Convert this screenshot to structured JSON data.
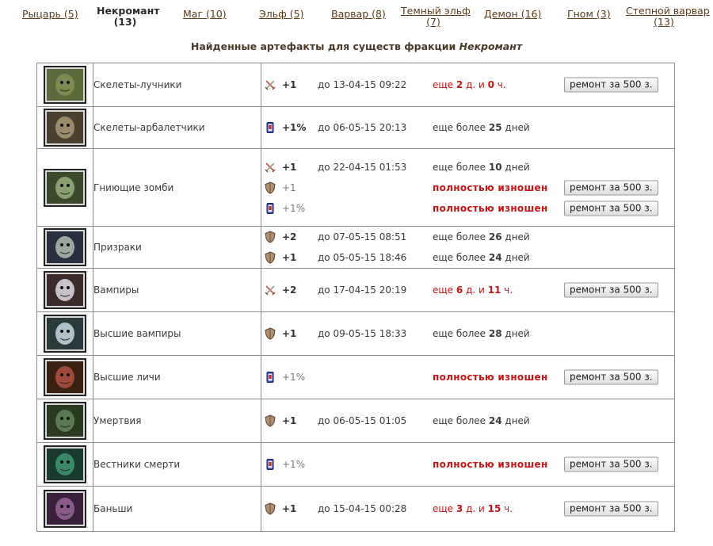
{
  "tabs": [
    {
      "label": "Рыцарь",
      "count": "(5)"
    },
    {
      "label": "Некромант",
      "count": "(13)"
    },
    {
      "label": "Маг",
      "count": "(10)"
    },
    {
      "label": "Эльф",
      "count": "(5)"
    },
    {
      "label": "Варвар",
      "count": "(8)"
    },
    {
      "label": "Темный эльф",
      "count": "(7)"
    },
    {
      "label": "Демон",
      "count": "(16)"
    },
    {
      "label": "Гном",
      "count": "(3)"
    },
    {
      "label": "Степной варвар",
      "count": "(13)"
    }
  ],
  "heading": {
    "prefix": "Найденные артефакты для существ фракции ",
    "faction": "Некромант"
  },
  "repair_label": "ремонт за 500 з.",
  "creatures": [
    {
      "name": "Скелеты-лучники",
      "artifacts": [
        {
          "icon": "swords-icon",
          "bonus": "+1",
          "date": "до 13-04-15 09:22",
          "status": {
            "pre": "еще ",
            "n1": "2",
            "mid": " д. и ",
            "n2": "0",
            "post": " ч."
          }
        }
      ]
    },
    {
      "name": "Скелеты-арбалетчики",
      "artifacts": [
        {
          "icon": "scroll-icon",
          "bonus": "+1%",
          "date": "до 06-05-15 20:13",
          "status": {
            "pre": "еще более ",
            "n1": "25",
            "post": " дней"
          }
        }
      ]
    },
    {
      "name": "Гниющие зомби",
      "artifacts": [
        {
          "icon": "swords-icon",
          "bonus": "+1",
          "date": "до 22-04-15 01:53",
          "status": {
            "pre": "еще более ",
            "n1": "10",
            "post": " дней"
          }
        },
        {
          "icon": "shield-icon",
          "bonus": "+1",
          "status": {
            "worn": "полностью изношен"
          }
        },
        {
          "icon": "scroll-icon",
          "bonus": "+1%",
          "status": {
            "worn": "полностью изношен"
          }
        }
      ]
    },
    {
      "name": "Призраки",
      "artifacts": [
        {
          "icon": "shield-icon",
          "bonus": "+2",
          "date": "до 07-05-15 08:51",
          "status": {
            "pre": "еще более ",
            "n1": "26",
            "post": " дней"
          }
        },
        {
          "icon": "shield-icon",
          "bonus": "+1",
          "date": "до 05-05-15 18:46",
          "status": {
            "pre": "еще более ",
            "n1": "24",
            "post": " дней"
          }
        }
      ]
    },
    {
      "name": "Вампиры",
      "artifacts": [
        {
          "icon": "swords-icon",
          "bonus": "+2",
          "date": "до 17-04-15 20:19",
          "status": {
            "pre": "еще ",
            "n1": "6",
            "mid": " д. и ",
            "n2": "11",
            "post": " ч."
          }
        }
      ]
    },
    {
      "name": "Высшие вампиры",
      "artifacts": [
        {
          "icon": "shield-icon",
          "bonus": "+1",
          "date": "до 09-05-15 18:33",
          "status": {
            "pre": "еще более ",
            "n1": "28",
            "post": " дней"
          }
        }
      ]
    },
    {
      "name": "Высшие личи",
      "artifacts": [
        {
          "icon": "scroll-icon",
          "bonus": "+1%",
          "status": {
            "worn": "полностью изношен"
          }
        }
      ]
    },
    {
      "name": "Умертвия",
      "artifacts": [
        {
          "icon": "shield-icon",
          "bonus": "+1",
          "date": "до 06-05-15 01:05",
          "status": {
            "pre": "еще более ",
            "n1": "24",
            "post": " дней"
          }
        }
      ]
    },
    {
      "name": "Вестники смерти",
      "artifacts": [
        {
          "icon": "scroll-icon",
          "bonus": "+1%",
          "status": {
            "worn": "полностью изношен"
          }
        }
      ]
    },
    {
      "name": "Баньши",
      "artifacts": [
        {
          "icon": "shield-icon",
          "bonus": "+1",
          "date": "до 15-04-15 00:28",
          "status": {
            "pre": "еще ",
            "n1": "3",
            "mid": " д. и ",
            "n2": "15",
            "post": " ч."
          }
        }
      ]
    }
  ]
}
